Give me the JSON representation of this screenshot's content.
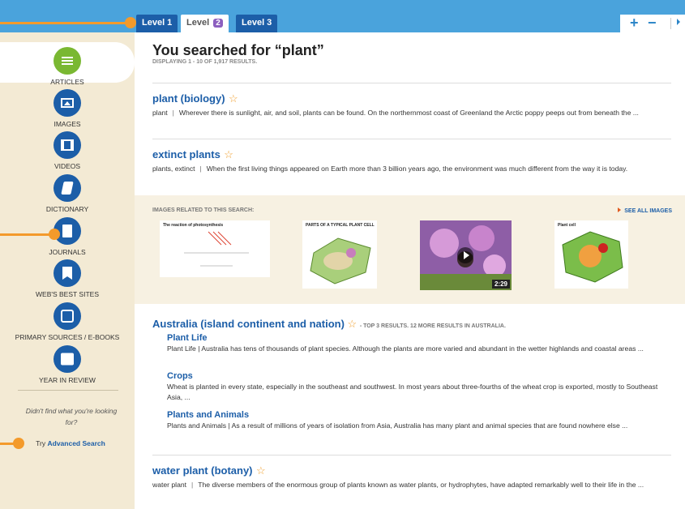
{
  "levels": [
    {
      "label": "Level 1"
    },
    {
      "label": "Level",
      "num": "2"
    },
    {
      "label": "Level 3"
    }
  ],
  "zoom": {
    "plus": "+",
    "minus": "−"
  },
  "sidebar": {
    "items": [
      {
        "label": "ARTICLES",
        "icon": "list-icon"
      },
      {
        "label": "IMAGES",
        "icon": "image-icon"
      },
      {
        "label": "VIDEOS",
        "icon": "film-icon"
      },
      {
        "label": "DICTIONARY",
        "icon": "book-icon"
      },
      {
        "label": "JOURNALS",
        "icon": "document-icon"
      },
      {
        "label": "WEB'S BEST SITES",
        "icon": "bookmark-icon"
      },
      {
        "label": "PRIMARY SOURCES / E-BOOKS",
        "icon": "edit-icon"
      },
      {
        "label": "YEAR IN REVIEW",
        "icon": "calendar-icon"
      }
    ],
    "didnt_find": "Didn't find what you're looking for?",
    "try_prefix": "Try",
    "advanced_search": "Advanced Search"
  },
  "search": {
    "title": "You searched for “plant”",
    "displaying": "DISPLAYING 1 - 10 OF 1,917 RESULTS."
  },
  "results": [
    {
      "title": "plant (biology)",
      "term": "plant",
      "snippet": "Wherever there is sunlight, air, and soil, plants can be found. On the northernmost coast of Greenland the Arctic poppy peeps out from beneath the ..."
    },
    {
      "title": "extinct plants",
      "term": "plants, extinct",
      "snippet": "When the first living things appeared on Earth more than 3 billion years ago, the environment was much different from the way it is today."
    }
  ],
  "images": {
    "label": "IMAGES RELATED TO THIS SEARCH:",
    "see_all": "SEE ALL IMAGES",
    "thumbs": [
      {
        "caption": "The reaction of photosynthesis"
      },
      {
        "caption": "PARTS OF A TYPICAL PLANT CELL"
      },
      {
        "caption": "",
        "duration": "2:29"
      },
      {
        "caption": "Plant cell"
      }
    ]
  },
  "australia": {
    "title": "Australia (island continent and nation)",
    "note": "- TOP 3 RESULTS. 12 MORE RESULTS IN AUSTRALIA.",
    "subs": [
      {
        "title": "Plant Life",
        "snippet": "Plant Life | Australia has tens of thousands of plant species. Although the plants are more varied and abundant in the wetter highlands and coastal areas ..."
      },
      {
        "title": "Crops",
        "snippet": "Wheat is planted in every state, especially in the southeast and southwest. In most years about three-fourths of the wheat crop is exported, mostly to Southeast Asia, ..."
      },
      {
        "title": "Plants and Animals",
        "snippet": "Plants and Animals | As a result of millions of years of isolation from Asia, Australia has many plant and animal species that are found nowhere else ..."
      }
    ]
  },
  "last_result": {
    "title": "water plant (botany)",
    "term": "water plant",
    "snippet": "The diverse members of the enormous group of plants known as water plants, or hydrophytes, have adapted remarkably well to their life in the ..."
  },
  "colors": {
    "accent": "#1c5ea8",
    "active_green": "#7ab832",
    "callout_orange": "#f39a2b",
    "sidebar_bg": "#f3ead4"
  }
}
